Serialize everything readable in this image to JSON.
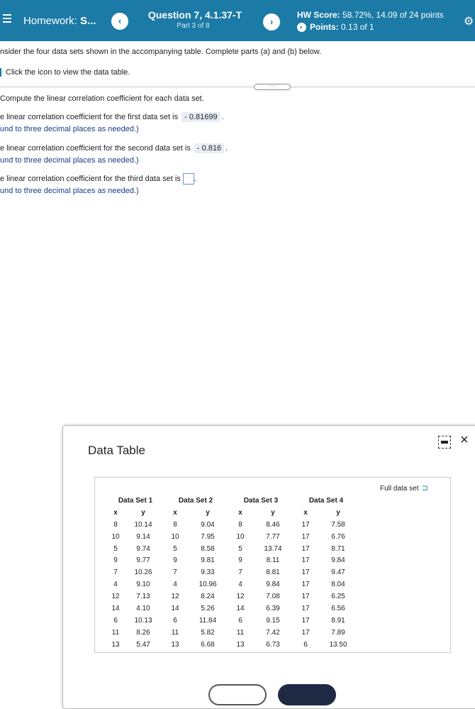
{
  "header": {
    "hw_label": "Homework:",
    "hw_name": "S...",
    "question_title": "Question 7, 4.1.37-T",
    "question_part": "Part 3 of 8",
    "score_label": "HW Score:",
    "score_value": "58.72%, 14.09 of 24 points",
    "points_label": "Points:",
    "points_value": "0.13 of 1",
    "prev_glyph": "‹",
    "next_glyph": "›"
  },
  "content": {
    "intro": "nsider the four data sets shown in the accompanying table. Complete parts (a) and (b) below.",
    "view_table": "Click the icon to view the data table.",
    "expander_dots": "·····",
    "part_prompt": "Compute the linear correlation coefficient for each data set.",
    "q1_text": "e linear correlation coefficient for the first data set is",
    "q1_answer": "- 0.81699",
    "q1_round": "und to three decimal places as needed.)",
    "q2_text": "e linear correlation coefficient for the second data set is",
    "q2_answer": "- 0.816",
    "q2_round": "und to three decimal places as needed.)",
    "q3_text": "e linear correlation coefficient for the third data set is",
    "q3_round": "und to three decimal places as needed.)"
  },
  "dialog": {
    "title": "Data Table",
    "full_data_label": "Full data set",
    "close_glyph": "×",
    "sets": [
      "Data Set 1",
      "Data Set 2",
      "Data Set 3",
      "Data Set 4"
    ],
    "var_x": "x",
    "var_y": "y",
    "rows": [
      [
        "8",
        "10.14",
        "8",
        "9.04",
        "8",
        "8.46",
        "17",
        "7.58"
      ],
      [
        "10",
        "9.14",
        "10",
        "7.95",
        "10",
        "7.77",
        "17",
        "6.76"
      ],
      [
        "5",
        "9.74",
        "5",
        "8.58",
        "5",
        "13.74",
        "17",
        "8.71"
      ],
      [
        "9",
        "9.77",
        "9",
        "9.81",
        "9",
        "8.11",
        "17",
        "9.84"
      ],
      [
        "7",
        "10.26",
        "7",
        "9.33",
        "7",
        "8.81",
        "17",
        "9.47"
      ],
      [
        "4",
        "9.10",
        "4",
        "10.96",
        "4",
        "9.84",
        "17",
        "8.04"
      ],
      [
        "12",
        "7.13",
        "12",
        "8.24",
        "12",
        "7.08",
        "17",
        "6.25"
      ],
      [
        "14",
        "4.10",
        "14",
        "5.26",
        "14",
        "6.39",
        "17",
        "6.56"
      ],
      [
        "6",
        "10.13",
        "6",
        "11.84",
        "6",
        "9.15",
        "17",
        "8.91"
      ],
      [
        "11",
        "8.26",
        "11",
        "5.82",
        "11",
        "7.42",
        "17",
        "7.89"
      ],
      [
        "13",
        "5.47",
        "13",
        "6.68",
        "13",
        "6.73",
        "6",
        "13.50"
      ]
    ]
  }
}
